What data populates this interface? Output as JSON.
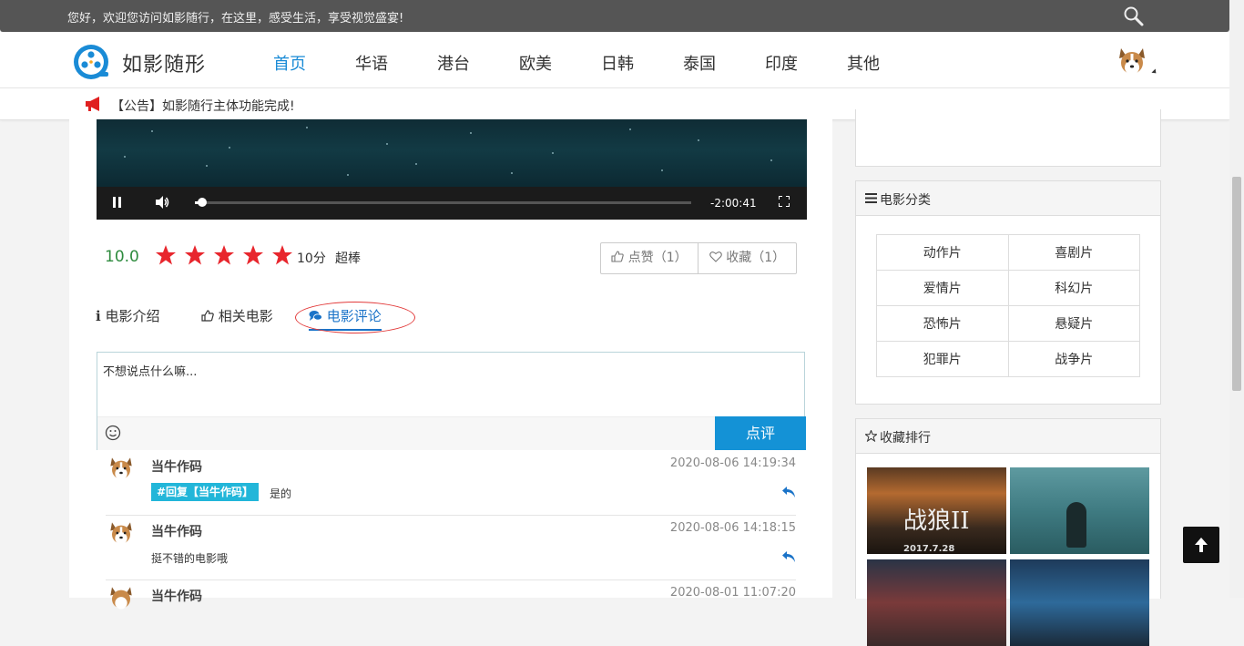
{
  "topbar": {
    "welcome": "您好，欢迎您访问如影随行，在这里，感受生活，享受视觉盛宴!"
  },
  "header": {
    "logo_text": "如影随形",
    "nav": [
      "首页",
      "华语",
      "港台",
      "欧美",
      "日韩",
      "泰国",
      "印度",
      "其他"
    ],
    "active_nav": "首页"
  },
  "notice": {
    "text": "【公告】如影随行主体功能完成!"
  },
  "player": {
    "time_remaining": "-2:00:41",
    "progress_fraction": 0.01
  },
  "rating": {
    "score": "10.0",
    "stars_filled": 5,
    "stars_total": 5,
    "points": "10分",
    "word": "超棒"
  },
  "actions": {
    "like": "点赞（1）",
    "favorite": "收藏（1）"
  },
  "tabs": [
    "电影介绍",
    "相关电影",
    "电影评论"
  ],
  "comment_form": {
    "placeholder": "不想说点什么嘛...",
    "submit": "点评"
  },
  "comments": [
    {
      "name": "当牛作码",
      "time": "2020-08-06 14:19:34",
      "reply_tag": "#回复【当牛作码】",
      "text": "是的"
    },
    {
      "name": "当牛作码",
      "time": "2020-08-06 14:18:15",
      "reply_tag": "",
      "text": "挺不错的电影哦"
    },
    {
      "name": "当牛作码",
      "time": "2020-08-01 11:07:20",
      "reply_tag": "",
      "text": ""
    }
  ],
  "sidebar": {
    "categories_title": "电影分类",
    "categories": [
      "动作片",
      "喜剧片",
      "爱情片",
      "科幻片",
      "恐怖片",
      "悬疑片",
      "犯罪片",
      "战争片"
    ],
    "ranking_title": "收藏排行",
    "ranking_posters": [
      {
        "caption": "战狼II",
        "subcaption": "2017.7.28"
      },
      {
        "caption": "",
        "subcaption": ""
      },
      {
        "caption": "",
        "subcaption": ""
      },
      {
        "caption": "",
        "subcaption": ""
      }
    ]
  },
  "colors": {
    "accent": "#1a8bd6",
    "submit": "#1492d6",
    "reply_tag": "#22b6d9",
    "star": "#e8262d",
    "score": "#2e8b3e",
    "annotation": "#e23a3a"
  }
}
